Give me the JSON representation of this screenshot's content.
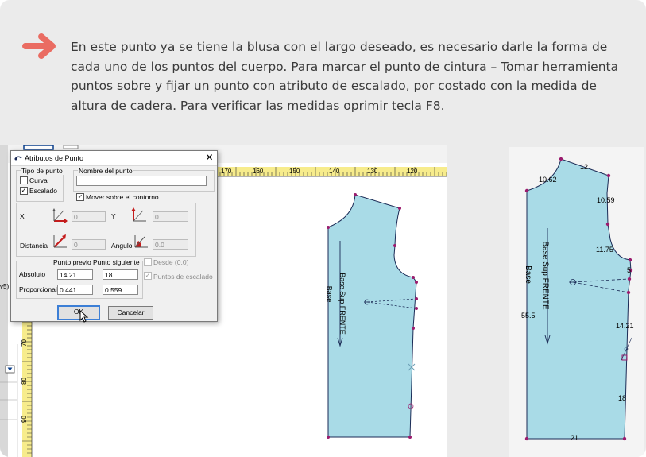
{
  "instruction": {
    "arrow_icon": "right-arrow-icon",
    "text": "En este punto ya se tiene la blusa con el largo deseado, es necesario darle la forma de cada uno de los puntos del cuerpo. Para marcar el punto de cintura – Tomar herramienta puntos sobre y fijar un punto con atributo de escalado, por costado con la medida de altura de cadera. Para verificar las medidas oprimir tecla F8.",
    "accent_color": "#ea6c62",
    "text_color": "#3a3a3a"
  },
  "cad": {
    "ruler_top_labels": [
      "170",
      "160",
      "150",
      "140",
      "130",
      "120"
    ],
    "ruler_left_labels": [
      "70",
      "80",
      "90"
    ],
    "side_label": "v5)",
    "pattern_label_1": "Base Sup FRENTE",
    "pattern_label_2": "Base",
    "fill_color": "#a9dbe7",
    "point_color": "#9b1c6e"
  },
  "dialog": {
    "title": "Atributos de Punto",
    "close": "✕",
    "tipo_de_punto": "Tipo de punto",
    "curva": "Curva",
    "curva_checked": false,
    "escalado": "Escalado",
    "escalado_checked": true,
    "nombre_label": "Nombre del punto",
    "nombre_value": "",
    "mover": "Mover sobre el contorno",
    "mover_checked": true,
    "x_label": "X",
    "x_value": "0",
    "y_label": "Y",
    "y_value": "0",
    "distancia_label": "Distancia",
    "distancia_value": "0",
    "angulo_label": "Angulo",
    "angulo_value": "0.0",
    "punto_previo": "Punto previo",
    "punto_siguiente": "Punto siguiente",
    "desde": "Desde (0,0)",
    "absoluto_label": "Absoluto",
    "absoluto_prev": "14.21",
    "absoluto_next": "18",
    "puntos_escalado": "Puntos de escalado",
    "proporcional_label": "Proporcional",
    "proporcional_prev": "0.441",
    "proporcional_next": "0.559",
    "ok": "OK",
    "cancel": "Cancelar"
  },
  "pattern_right": {
    "label_1": "Base Sup FRENTE",
    "label_2": "Base",
    "measures": [
      "12",
      "10.62",
      "10.59",
      "11.75",
      "5",
      "55.5",
      "14.21",
      "18",
      "21"
    ]
  }
}
